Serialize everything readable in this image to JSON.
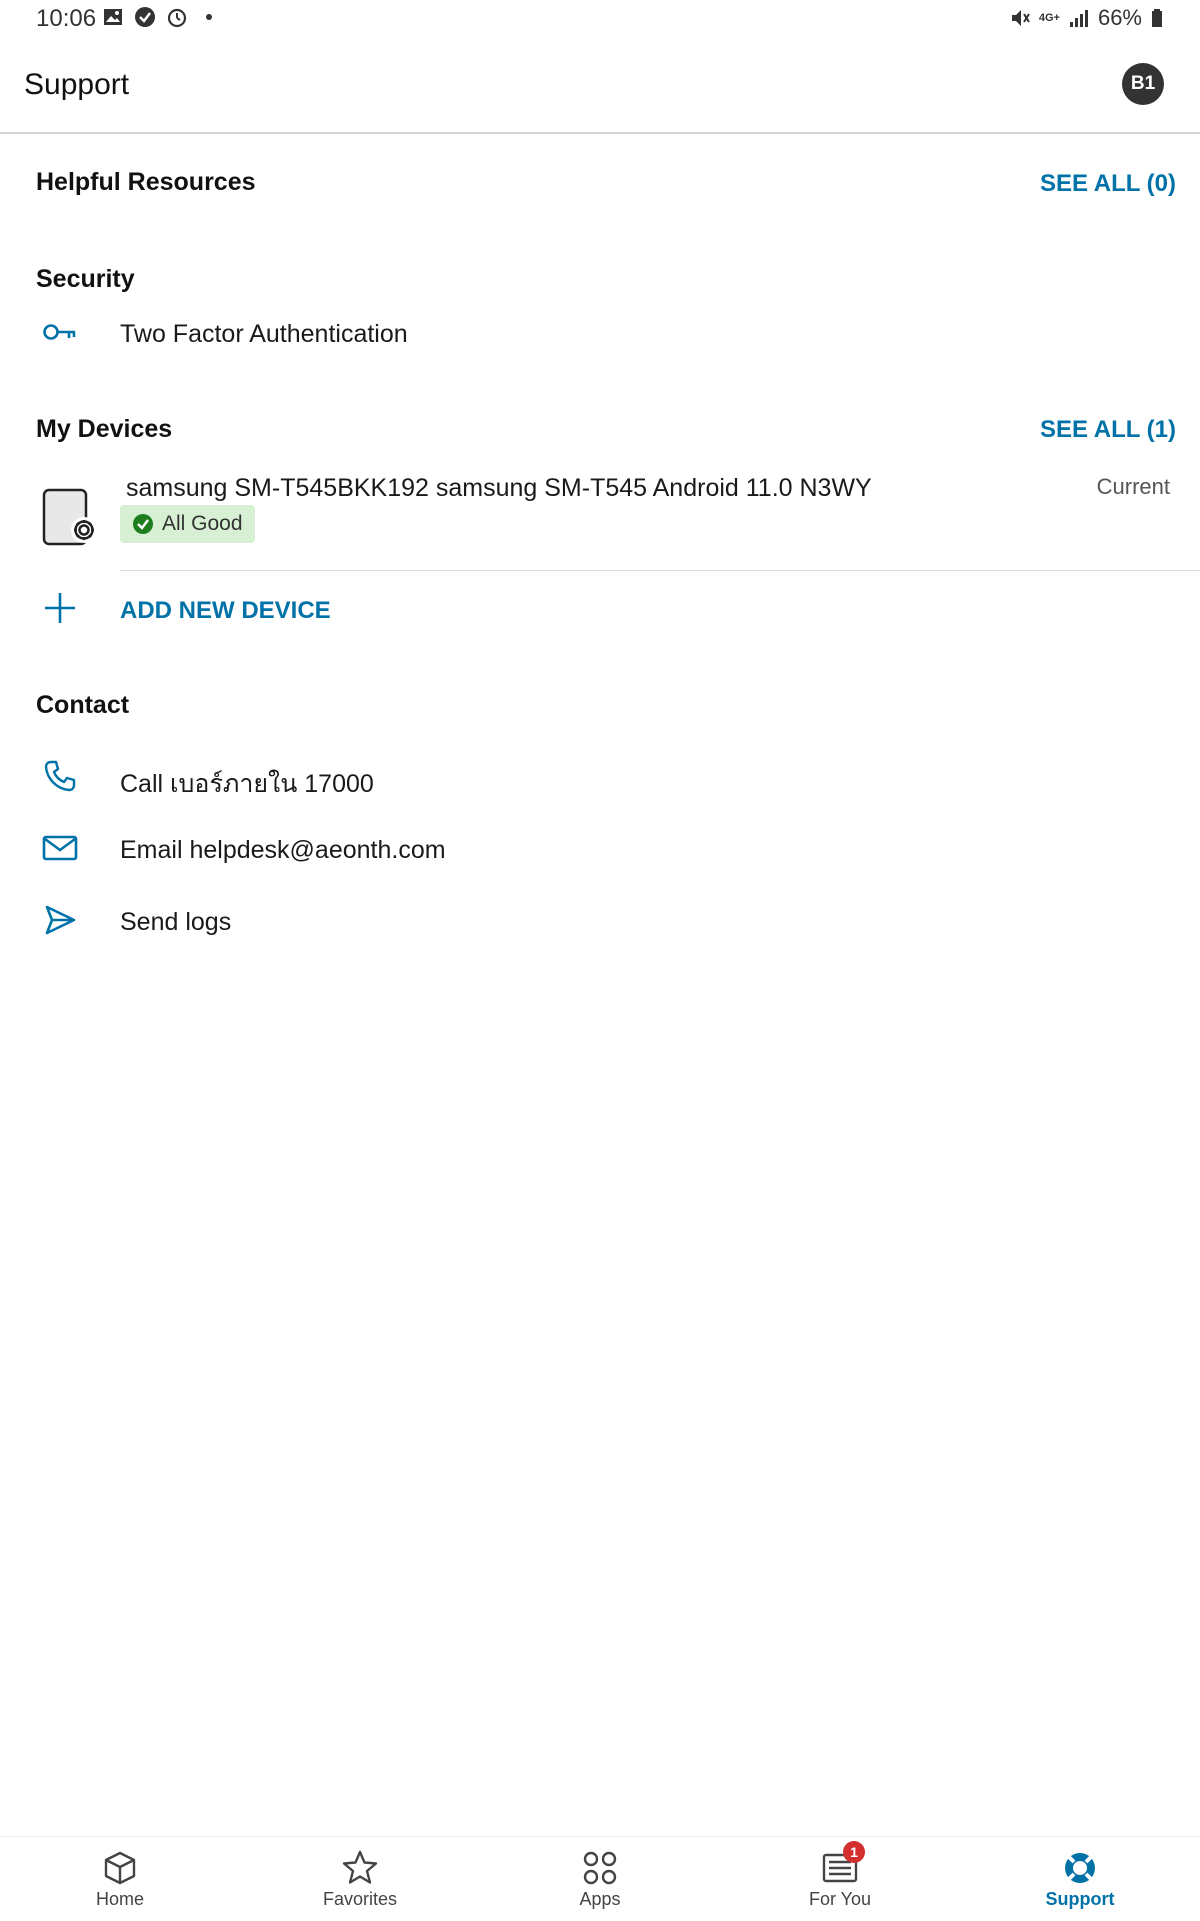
{
  "status_bar": {
    "time": "10:06",
    "battery": "66%",
    "network": "4G+",
    "left_icons": [
      "gallery-icon",
      "check-circle-icon",
      "timer-icon",
      "dot-icon"
    ],
    "right_icons": [
      "mute-icon",
      "network-icon",
      "signal-icon",
      "battery-icon"
    ]
  },
  "header": {
    "title": "Support",
    "avatar_initials": "B1"
  },
  "helpful_resources": {
    "title": "Helpful Resources",
    "see_all": "SEE ALL (0)"
  },
  "security": {
    "title": "Security",
    "items": [
      {
        "icon": "key-icon",
        "label": "Two Factor Authentication"
      }
    ]
  },
  "my_devices": {
    "title": "My Devices",
    "see_all": "SEE ALL (1)",
    "devices": [
      {
        "name": "samsung SM-T545BKK192 samsung SM-T545 Android 11.0 N3WY",
        "status": "All Good",
        "tag": "Current",
        "icon": "tablet-settings-icon"
      }
    ],
    "add_new": "ADD NEW DEVICE"
  },
  "contact": {
    "title": "Contact",
    "items": [
      {
        "icon": "phone-icon",
        "label": "Call เบอร์ภายใน 17000"
      },
      {
        "icon": "mail-icon",
        "label": "Email helpdesk@aeonth.com"
      },
      {
        "icon": "send-icon",
        "label": "Send logs"
      }
    ]
  },
  "bottom_nav": {
    "items": [
      {
        "label": "Home",
        "icon": "cube-icon"
      },
      {
        "label": "Favorites",
        "icon": "star-icon"
      },
      {
        "label": "Apps",
        "icon": "apps-grid-icon"
      },
      {
        "label": "For You",
        "icon": "news-icon",
        "badge": "1"
      },
      {
        "label": "Support",
        "icon": "lifebuoy-icon",
        "active": true
      }
    ]
  },
  "colors": {
    "accent": "#0072a8",
    "badge_bg": "#d7f0d4",
    "badge_check": "#1e7d1e",
    "notification": "#d32f2f"
  }
}
